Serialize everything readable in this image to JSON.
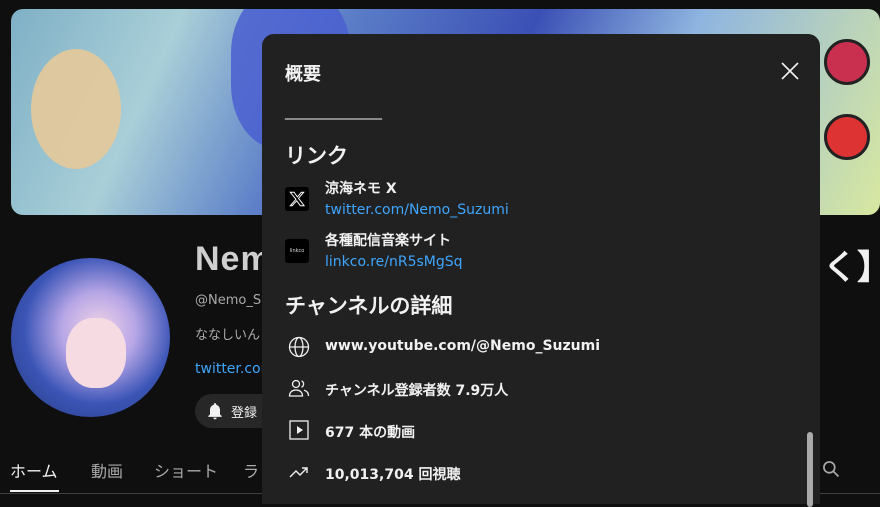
{
  "background": {
    "channel_name_visible": "Nem",
    "channel_name_right_visible": "く】",
    "handle": "@Nemo_Su",
    "description_partial": "ななしいん",
    "link_partial": "twitter.com",
    "subscribe_label": "登録",
    "tabs": [
      {
        "label": "ホーム",
        "active": true
      },
      {
        "label": "動画",
        "active": false
      },
      {
        "label": "ショート",
        "active": false
      },
      {
        "label": "ラ",
        "active": false
      }
    ]
  },
  "modal": {
    "title": "概要",
    "divider_text": "________________",
    "links_heading": "リンク",
    "links": [
      {
        "icon": "x-logo-icon",
        "label": "涼海ネモ X",
        "url": "twitter.com/Nemo_Suzumi"
      },
      {
        "icon": "linkco-logo-icon",
        "icon_text": "linkco",
        "label": "各種配信音楽サイト",
        "url": "linkco.re/nR5sMgSq"
      }
    ],
    "details_heading": "チャンネルの詳細",
    "details": [
      {
        "icon": "globe-icon",
        "text": "www.youtube.com/@Nemo_Suzumi"
      },
      {
        "icon": "subscribers-icon",
        "text": "チャンネル登録者数 7.9万人"
      },
      {
        "icon": "video-play-icon",
        "text": "677 本の動画"
      },
      {
        "icon": "trending-icon",
        "text": "10,013,704 回視聴"
      }
    ]
  },
  "colors": {
    "page_bg": "#0f0f0f",
    "modal_bg": "#212121",
    "link": "#3ea6ff",
    "text": "#f1f1f1"
  }
}
